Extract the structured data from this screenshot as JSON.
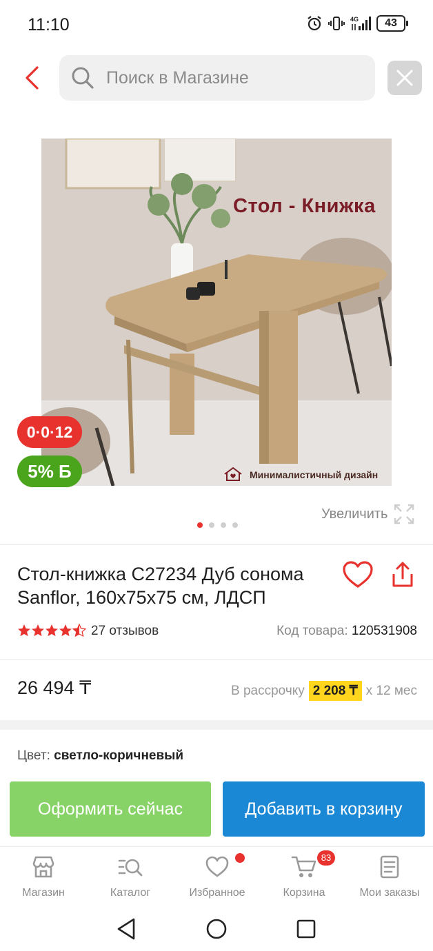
{
  "status": {
    "time": "11:10",
    "battery": "43",
    "network": "4G"
  },
  "search": {
    "placeholder": "Поиск в Магазине"
  },
  "gallery": {
    "photo_title": "Стол - Книжка",
    "photo_caption": "Минималистичный дизайн",
    "badge_installment": "0·0·12",
    "badge_bonus": "5% Б",
    "zoom_label": "Увеличить",
    "slide_count": 4,
    "active_slide": 1
  },
  "product": {
    "title": "Стол-книжка С27234 Дуб сонома Sanflor, 160х75х75 см, ЛДСП",
    "rating": 4.5,
    "reviews": "27 отзывов",
    "sku_label": "Код товара:",
    "sku_value": "120531908",
    "price": "26 494 ₸",
    "installment_prefix": "В рассрочку",
    "installment_amount": "2 208 ₸",
    "installment_suffix": "х 12 мес",
    "color_label": "Цвет:",
    "color_value": "светло-коричневый"
  },
  "actions": {
    "buy_now": "Оформить сейчас",
    "add_to_cart": "Добавить в корзину"
  },
  "tabbar": {
    "items": [
      {
        "label": "Магазин",
        "icon": "store-icon"
      },
      {
        "label": "Каталог",
        "icon": "catalog-search-icon"
      },
      {
        "label": "Избранное",
        "icon": "heart-icon"
      },
      {
        "label": "Корзина",
        "icon": "cart-icon"
      },
      {
        "label": "Мои заказы",
        "icon": "orders-icon"
      }
    ],
    "cart_count": "83"
  },
  "colors": {
    "accent_red": "#e8322e",
    "buy_green": "#88d368",
    "cart_blue": "#1b88d6",
    "installment_yellow": "#ffd51e",
    "bonus_green": "#4aa51c"
  }
}
